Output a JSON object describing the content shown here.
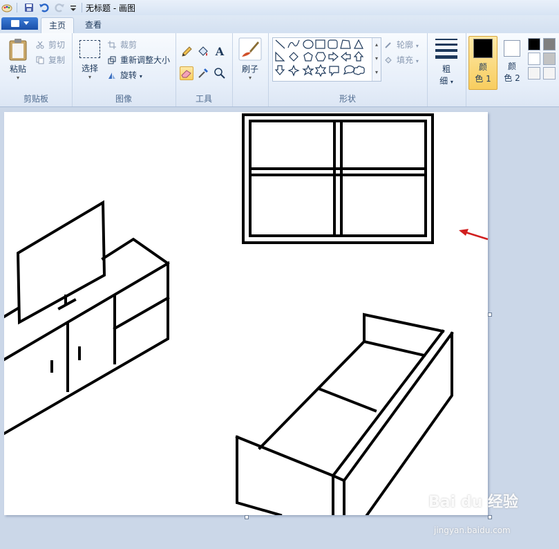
{
  "window": {
    "title": "无标题 - 画图"
  },
  "tabs": [
    {
      "label": "主页",
      "active": true
    },
    {
      "label": "查看",
      "active": false
    }
  ],
  "clipboard": {
    "paste": "粘贴",
    "cut": "剪切",
    "copy": "复制",
    "group": "剪贴板"
  },
  "image": {
    "select": "选择",
    "crop": "裁剪",
    "resize": "重新调整大小",
    "rotate": "旋转",
    "group": "图像"
  },
  "tools": {
    "group": "工具",
    "pencil": "pencil-icon",
    "fill": "fill-bucket-icon",
    "text": "A",
    "eraser": "eraser-icon",
    "picker": "color-picker-icon",
    "magnifier": "magnifier-icon"
  },
  "brushes": {
    "label": "刷子"
  },
  "shapes": {
    "group": "形状",
    "outline": "轮廓",
    "fill": "填充"
  },
  "size": {
    "label_line1": "粗",
    "label_line2": "细"
  },
  "colors": {
    "color1_line1": "颜",
    "color1_line2": "色 1",
    "color2_line1": "颜",
    "color2_line2": "色 2",
    "color1": "#000000",
    "color2": "#ffffff",
    "palette": [
      "#000000",
      "#7f7f7f",
      "#ffffff",
      "#c3c3c3"
    ]
  },
  "watermark": {
    "brand": "Bai du 经验",
    "url": "jingyan.baidu.com"
  }
}
